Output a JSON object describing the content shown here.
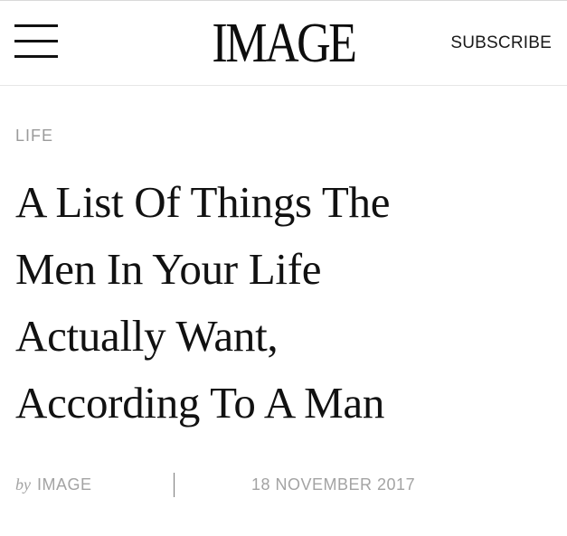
{
  "header": {
    "logo_text": "IMAGE",
    "subscribe_label": "SUBSCRIBE",
    "menu_icon": "hamburger-menu-icon"
  },
  "article": {
    "category": "LIFE",
    "headline_lines": [
      "A List Of Things The",
      "Men In Your Life",
      "Actually Want,",
      "According To A Man"
    ],
    "byline": {
      "by_word": "by",
      "author": "IMAGE",
      "date": "18 NOVEMBER 2017"
    }
  },
  "colors": {
    "text": "#111111",
    "muted": "#9b9b9b",
    "divider": "#e6e6e6"
  }
}
